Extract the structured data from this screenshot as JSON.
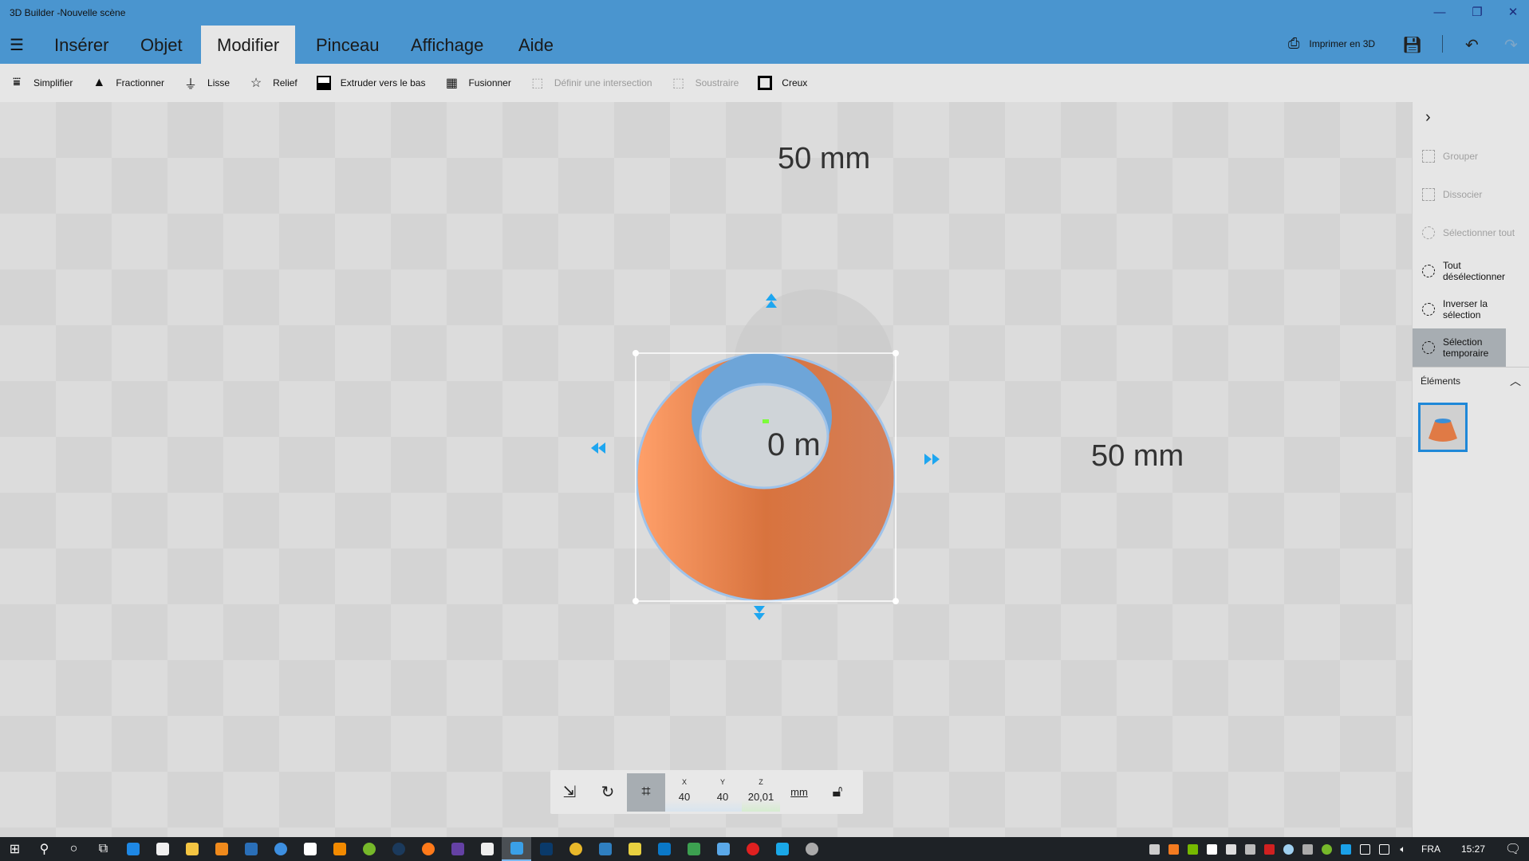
{
  "window": {
    "title": "3D Builder -Nouvelle scène"
  },
  "menu": {
    "tabs": [
      "Insérer",
      "Objet",
      "Modifier",
      "Pinceau",
      "Affichage",
      "Aide"
    ],
    "active": "Modifier",
    "print_label": "Imprimer en 3D"
  },
  "toolbar": {
    "items": [
      {
        "label": "Simplifier",
        "icon": "simplify-icon",
        "enabled": true
      },
      {
        "label": "Fractionner",
        "icon": "split-icon",
        "enabled": true
      },
      {
        "label": "Lisse",
        "icon": "smooth-icon",
        "enabled": true
      },
      {
        "label": "Relief",
        "icon": "star-icon",
        "enabled": true
      },
      {
        "label": "Extruder vers le bas",
        "icon": "extrude-icon",
        "enabled": true
      },
      {
        "label": "Fusionner",
        "icon": "merge-icon",
        "enabled": true
      },
      {
        "label": "Définir une intersection",
        "icon": "intersect-icon",
        "enabled": false
      },
      {
        "label": "Soustraire",
        "icon": "subtract-icon",
        "enabled": false
      },
      {
        "label": "Creux",
        "icon": "hollow-icon",
        "enabled": true
      }
    ]
  },
  "viewport": {
    "dim_top": "50 mm",
    "dim_right": "50 mm",
    "dim_center": "0 m",
    "object_color": "#e07a45",
    "inner_color": "#6fa6d8",
    "handle_color": "#1ea6f0"
  },
  "rightpanel": {
    "items": [
      {
        "label": "Grouper",
        "enabled": false
      },
      {
        "label": "Dissocier",
        "enabled": false
      },
      {
        "label": "Sélectionner tout",
        "enabled": false
      },
      {
        "label": "Tout désélectionner",
        "enabled": true
      },
      {
        "label": "Inverser la sélection",
        "enabled": true
      },
      {
        "label": "Sélection temporaire",
        "enabled": true,
        "active": true
      }
    ],
    "elements_label": "Éléments"
  },
  "bottombar": {
    "x_label": "X",
    "x": "40",
    "y_label": "Y",
    "y": "40",
    "z_label": "Z",
    "z": "20,01",
    "unit": "mm"
  },
  "taskbar": {
    "apps": [
      "windows-start",
      "search",
      "cortana",
      "task-view",
      "edge",
      "store",
      "explorer",
      "media-player",
      "app",
      "app",
      "mail",
      "vlc",
      "utorrent",
      "steam",
      "firefox",
      "twitch",
      "camera",
      "3d-builder",
      "app",
      "chrome",
      "app",
      "app",
      "app",
      "app",
      "app",
      "app",
      "app",
      "app"
    ],
    "tray_icons": [
      "plane",
      "avast",
      "nvidia",
      "defender",
      "app",
      "printer",
      "cpu",
      "drop",
      "app",
      "utorrent",
      "logitech",
      "usb",
      "network",
      "volume"
    ],
    "lang": "FRA",
    "time": "15:27"
  }
}
